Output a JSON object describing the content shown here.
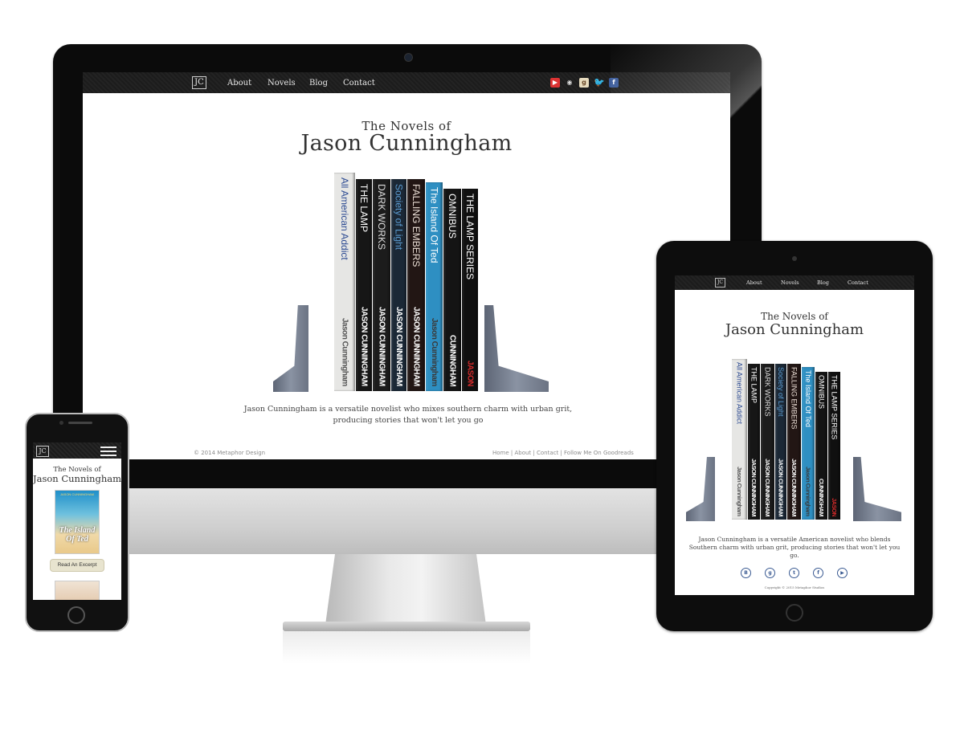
{
  "site": {
    "logo": "JC",
    "nav": [
      "About",
      "Novels",
      "Blog",
      "Contact"
    ],
    "title_line1": "The Novels of",
    "title_line2": "Jason Cunningham"
  },
  "desktop": {
    "intro": "Jason Cunningham is a versatile novelist who  mixes southern charm with urban grit, producing stories that won't let you go",
    "footer_left": "© 2014 Metaphor Design",
    "footer_right": "Home | About | Contact | Follow Me On Goodreads",
    "social_icons": [
      "youtube-icon",
      "rss-icon",
      "goodreads-icon",
      "twitter-icon",
      "facebook-icon"
    ]
  },
  "books": [
    {
      "title": "All American Addict",
      "author": "Jason Cunningham",
      "spine": "#e6e6e4",
      "title_color": "#2e4c93",
      "author_color": "#555555"
    },
    {
      "title": "THE LAMP",
      "author": "JASON CUNNINGHAM",
      "spine": "#161616",
      "title_color": "#ffffff",
      "author_color": "#ffffff"
    },
    {
      "title": "DARK WORKS",
      "author": "JASON CUNNINGHAM",
      "spine": "#1c1c1c",
      "title_color": "#dddddd",
      "author_color": "#ffffff"
    },
    {
      "title": "Society of Light",
      "author": "JASON CUNNINGHAM",
      "spine": "#1b2836",
      "title_color": "#5b9bd0",
      "author_color": "#ffffff"
    },
    {
      "title": "FALLING EMBERS",
      "author": "JASON CUNNINGHAM",
      "spine": "#221614",
      "title_color": "#e9ddd4",
      "author_color": "#ffffff"
    },
    {
      "title": "The Island Of Ted",
      "author": "Jason Cunningham",
      "spine": "#2e8fc2",
      "title_color": "#ffffff",
      "author_color": "#3a3a3a"
    },
    {
      "title": "OMNIBUS",
      "author": "CUNNINGHAM",
      "spine": "#141414",
      "title_color": "#ffffff",
      "author_color": "#ffffff"
    },
    {
      "title": "THE LAMP SERIES",
      "author": "JASON",
      "spine": "#101010",
      "title_color": "#ffffff",
      "author_color": "#d42a2a"
    }
  ],
  "tablet": {
    "intro": "Jason Cunningham is a versatile American novelist who blends Southern charm with urban grit, producing stories that won't let you go.",
    "copyright": "Copyright © 2015 Metaphor Studios",
    "social_icons": [
      "blogger-icon",
      "goodreads-icon",
      "twitter-icon",
      "facebook-icon",
      "youtube-icon"
    ]
  },
  "phone": {
    "cover_author": "JASON CUNNINGHAM",
    "cover_title": "The Island Of Ted",
    "button": "Read An Excerpt"
  }
}
